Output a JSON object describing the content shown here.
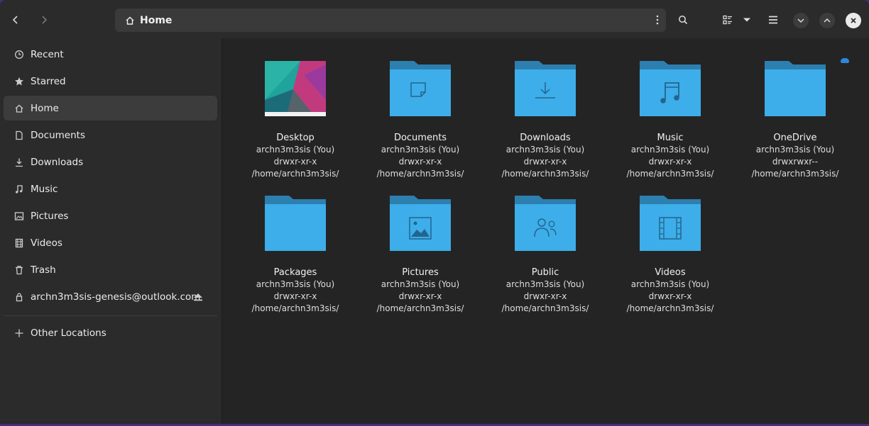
{
  "header": {
    "location_label": "Home"
  },
  "sidebar": {
    "items": [
      {
        "label": "Recent",
        "icon": "clock-icon"
      },
      {
        "label": "Starred",
        "icon": "star-icon"
      },
      {
        "label": "Home",
        "icon": "home-icon",
        "active": true
      },
      {
        "label": "Documents",
        "icon": "document-icon"
      },
      {
        "label": "Downloads",
        "icon": "download-icon"
      },
      {
        "label": "Music",
        "icon": "music-note-icon"
      },
      {
        "label": "Pictures",
        "icon": "image-icon"
      },
      {
        "label": "Videos",
        "icon": "film-icon"
      },
      {
        "label": "Trash",
        "icon": "trash-icon"
      }
    ],
    "account": {
      "label": "archn3m3sis-genesis@outlook.com",
      "icon": "lock-icon"
    },
    "other_locations": {
      "label": "Other Locations",
      "icon": "plus-icon"
    }
  },
  "files": [
    {
      "name": "Desktop",
      "owner": "archn3m3sis (You)",
      "perms": "drwxr-xr-x",
      "path": "/home/archn3m3sis/",
      "icon": "desktop-thumbnail"
    },
    {
      "name": "Documents",
      "owner": "archn3m3sis (You)",
      "perms": "drwxr-xr-x",
      "path": "/home/archn3m3sis/",
      "icon": "folder-documents-icon"
    },
    {
      "name": "Downloads",
      "owner": "archn3m3sis (You)",
      "perms": "drwxr-xr-x",
      "path": "/home/archn3m3sis/",
      "icon": "folder-download-icon"
    },
    {
      "name": "Music",
      "owner": "archn3m3sis (You)",
      "perms": "drwxr-xr-x",
      "path": "/home/archn3m3sis/",
      "icon": "folder-music-icon"
    },
    {
      "name": "OneDrive",
      "owner": "archn3m3sis (You)",
      "perms": "drwxrwxr--",
      "path": "/home/archn3m3sis/",
      "icon": "folder-icon"
    },
    {
      "name": "Packages",
      "owner": "archn3m3sis (You)",
      "perms": "drwxr-xr-x",
      "path": "/home/archn3m3sis/",
      "icon": "folder-icon"
    },
    {
      "name": "Pictures",
      "owner": "archn3m3sis (You)",
      "perms": "drwxr-xr-x",
      "path": "/home/archn3m3sis/",
      "icon": "folder-pictures-icon"
    },
    {
      "name": "Public",
      "owner": "archn3m3sis (You)",
      "perms": "drwxr-xr-x",
      "path": "/home/archn3m3sis/",
      "icon": "folder-public-icon"
    },
    {
      "name": "Videos",
      "owner": "archn3m3sis (You)",
      "perms": "drwxr-xr-x",
      "path": "/home/archn3m3sis/",
      "icon": "folder-videos-icon"
    }
  ],
  "colors": {
    "folder_body": "#3daee9",
    "folder_tab": "#2d7fb0",
    "window_bg": "#242424",
    "sidebar_bg": "#2b2b2b",
    "active_item_bg": "#3c3c3c"
  }
}
